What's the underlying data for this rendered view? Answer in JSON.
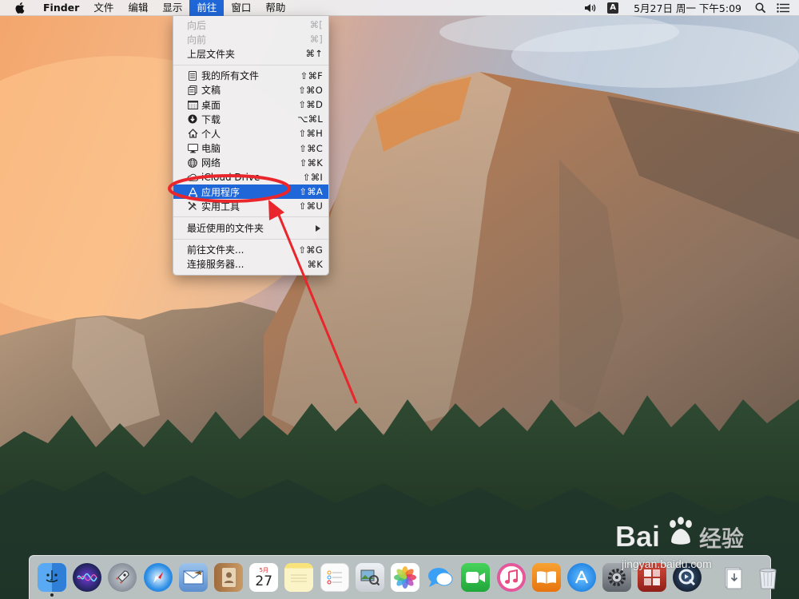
{
  "menubar": {
    "app_name": "Finder",
    "menus": [
      "文件",
      "编辑",
      "显示",
      "前往",
      "窗口",
      "帮助"
    ],
    "active_menu": "前往",
    "input_method": "A",
    "clock": "5月27日 周一 下午5:09"
  },
  "go_menu": {
    "items": [
      {
        "label": "向后",
        "shortcut": "⌘[",
        "disabled": true,
        "icon": ""
      },
      {
        "label": "向前",
        "shortcut": "⌘]",
        "disabled": true,
        "icon": ""
      },
      {
        "label": "上层文件夹",
        "shortcut": "⌘↑",
        "disabled": false,
        "icon": ""
      },
      {
        "label": "我的所有文件",
        "shortcut": "⇧⌘F",
        "icon": "all-files-icon"
      },
      {
        "label": "文稿",
        "shortcut": "⇧⌘O",
        "icon": "documents-icon"
      },
      {
        "label": "桌面",
        "shortcut": "⇧⌘D",
        "icon": "desktop-icon"
      },
      {
        "label": "下载",
        "shortcut": "⌥⌘L",
        "icon": "downloads-icon"
      },
      {
        "label": "个人",
        "shortcut": "⇧⌘H",
        "icon": "home-icon"
      },
      {
        "label": "电脑",
        "shortcut": "⇧⌘C",
        "icon": "computer-icon"
      },
      {
        "label": "网络",
        "shortcut": "⇧⌘K",
        "icon": "network-icon"
      },
      {
        "label": "iCloud Drive",
        "shortcut": "⇧⌘I",
        "icon": "icloud-icon"
      },
      {
        "label": "应用程序",
        "shortcut": "⇧⌘A",
        "icon": "applications-icon",
        "highlighted": true
      },
      {
        "label": "实用工具",
        "shortcut": "⇧⌘U",
        "icon": "utilities-icon"
      },
      {
        "label": "最近使用的文件夹",
        "shortcut": "",
        "submenu": true
      },
      {
        "label": "前往文件夹...",
        "shortcut": "⇧⌘G"
      },
      {
        "label": "连接服务器...",
        "shortcut": "⌘K"
      }
    ]
  },
  "dock": {
    "apps": [
      {
        "name": "finder-icon",
        "color": "#3d8ee8"
      },
      {
        "name": "siri-icon",
        "color": "#2a2f5a"
      },
      {
        "name": "launchpad-icon",
        "color": "#9aa3ad"
      },
      {
        "name": "safari-icon",
        "color": "#2d8fe6"
      },
      {
        "name": "mail-icon",
        "color": "#7aa7d8"
      },
      {
        "name": "contacts-icon",
        "color": "#b98a5a"
      },
      {
        "name": "calendar-icon",
        "color": "#ffffff",
        "month": "5月",
        "day": "27"
      },
      {
        "name": "notes-icon",
        "color": "#f6e58b"
      },
      {
        "name": "reminders-icon",
        "color": "#fafafa"
      },
      {
        "name": "preview-icon",
        "color": "#d9dde2"
      },
      {
        "name": "photos-icon",
        "color": "#ffffff"
      },
      {
        "name": "messages-icon",
        "color": "#3aa0f5"
      },
      {
        "name": "facetime-icon",
        "color": "#2fbf4a"
      },
      {
        "name": "itunes-icon",
        "color": "#f05a8c"
      },
      {
        "name": "ibooks-icon",
        "color": "#f08a1c"
      },
      {
        "name": "app-store-icon",
        "color": "#2f9bf0"
      },
      {
        "name": "system-preferences-icon",
        "color": "#7b7f86"
      },
      {
        "name": "photo-booth-icon",
        "color": "#c8362e"
      },
      {
        "name": "quicktime-icon",
        "color": "#1e2a3a"
      },
      {
        "name": "downloads-stack-icon",
        "color": "#e4e6ea"
      },
      {
        "name": "trash-icon",
        "color": "#e0e4ea"
      }
    ]
  },
  "watermark": {
    "brand": "Bai du 经验",
    "url": "jingyan.baidu.com"
  },
  "colors": {
    "menu_highlight": "#1f67d8",
    "annotation_red": "#e8262c"
  }
}
